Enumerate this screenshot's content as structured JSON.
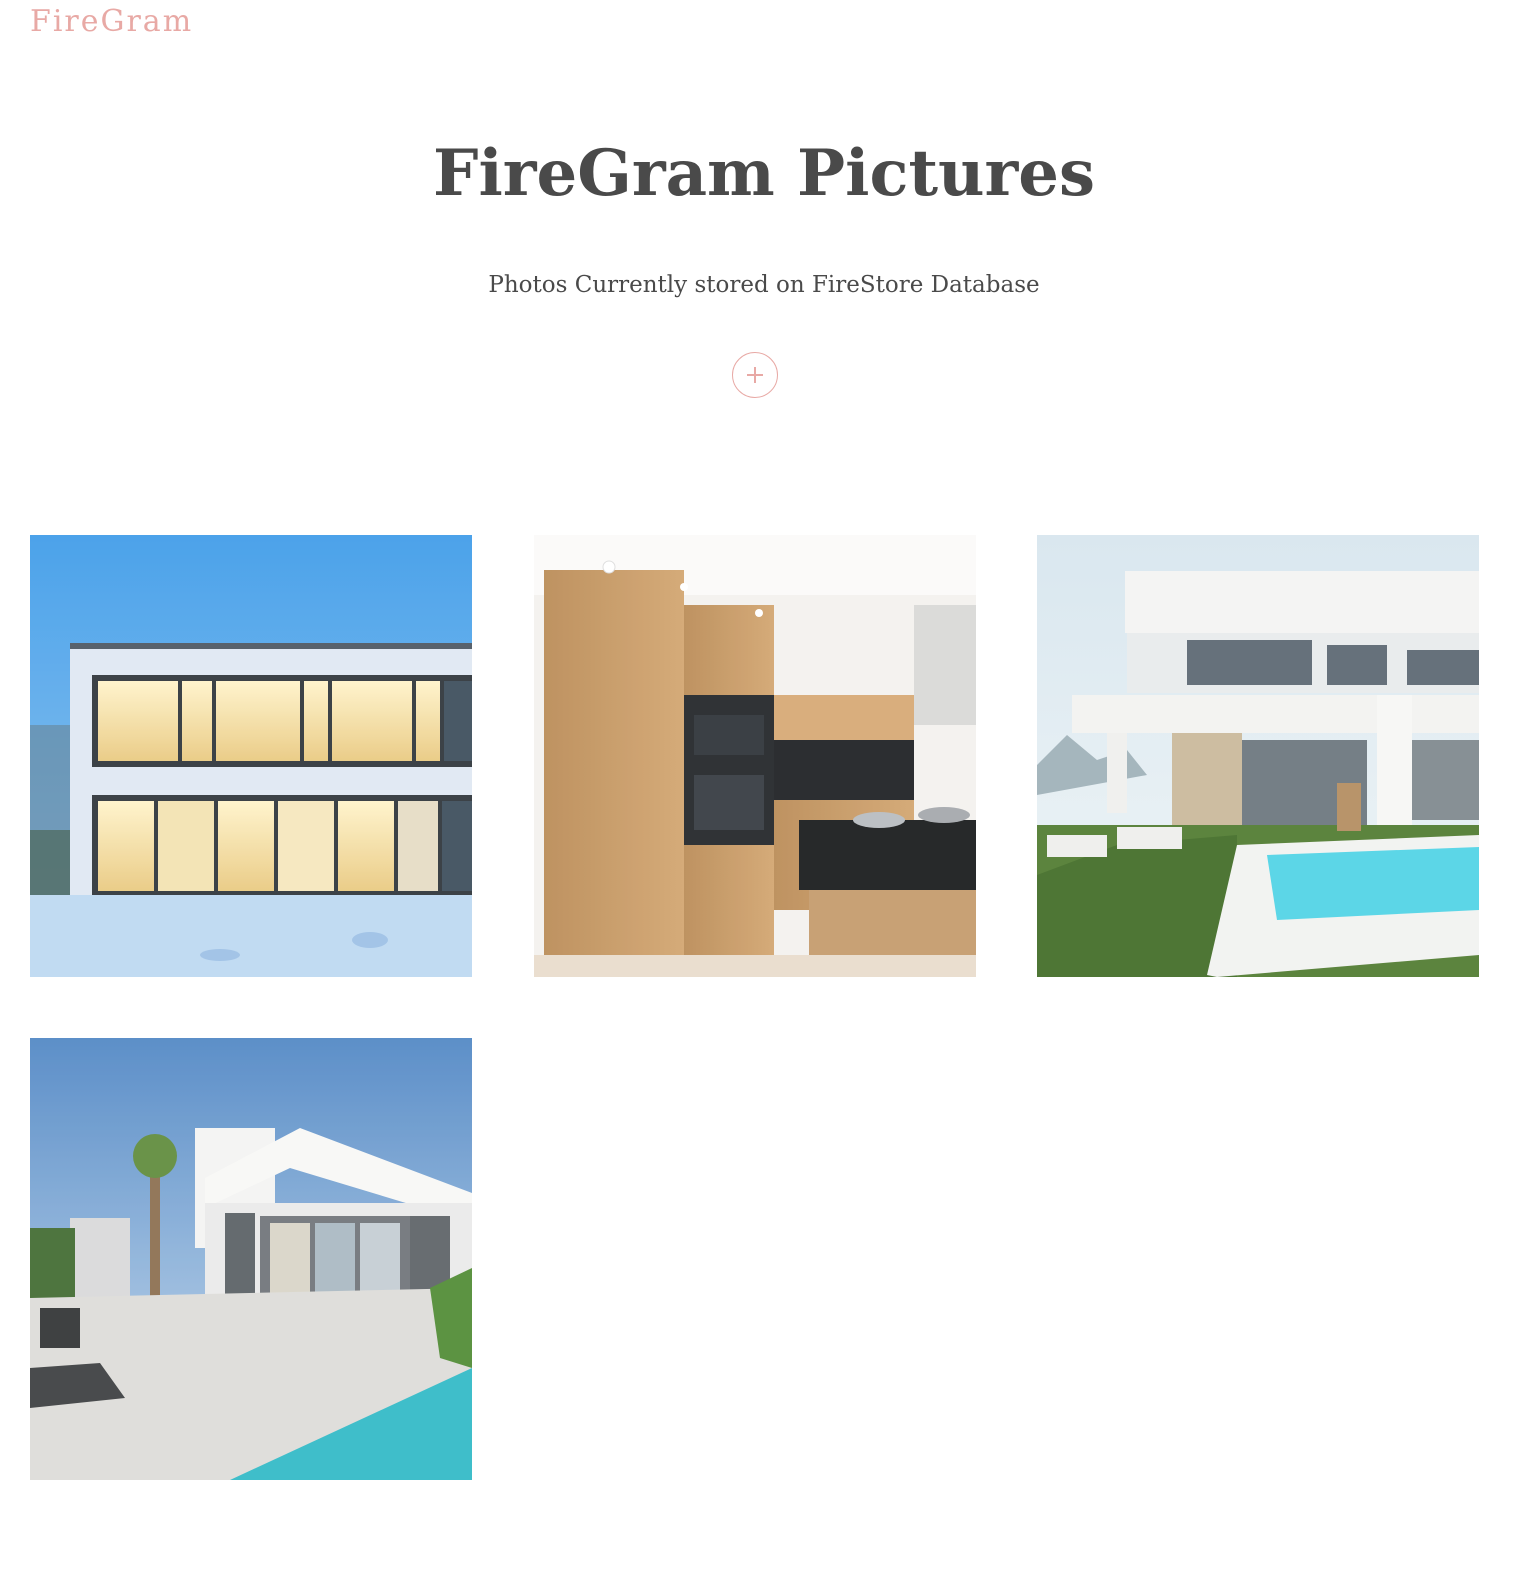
{
  "navbar": {
    "brand": "FireGram"
  },
  "header": {
    "title": "FireGram Pictures",
    "subtitle": "Photos Currently stored on FireStore Database"
  },
  "upload": {
    "icon": "plus-icon"
  },
  "gallery": {
    "images": [
      {
        "subject": "modern two-story house in snow at dusk"
      },
      {
        "subject": "wooden kitchen with black countertop"
      },
      {
        "subject": "white villa with pool and lawn"
      },
      {
        "subject": "white house with palm tree and pool"
      }
    ]
  },
  "colors": {
    "accent": "#e8a9a5",
    "text": "#4a4a4a",
    "background": "#ffffff"
  }
}
